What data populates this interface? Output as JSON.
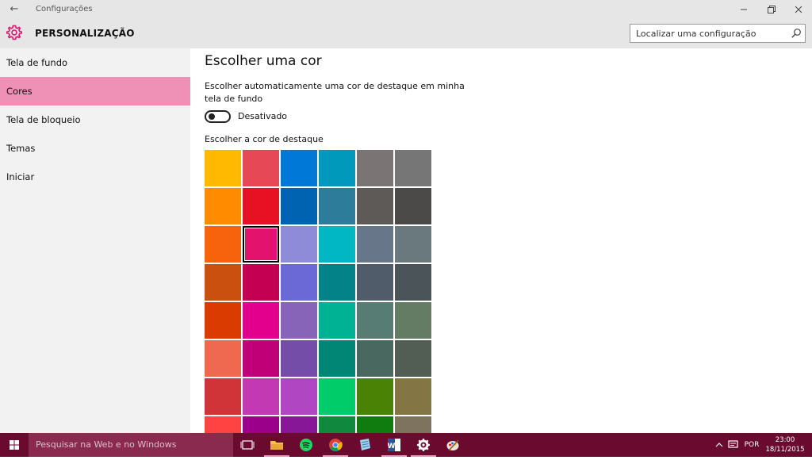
{
  "window": {
    "back_glyph": "←",
    "title": "Configurações",
    "controls": [
      "minimize-icon",
      "restore-icon",
      "close-icon"
    ]
  },
  "header": {
    "title": "PERSONALIZAÇÃO",
    "icon": "gear-icon",
    "accent_color": "#e3126d",
    "search_placeholder": "Localizar uma configuração"
  },
  "sidebar": {
    "active_index": 1,
    "active_color": "#ef90b7",
    "items": [
      {
        "label": "Tela de fundo"
      },
      {
        "label": "Cores"
      },
      {
        "label": "Tela de bloqueio"
      },
      {
        "label": "Temas"
      },
      {
        "label": "Iniciar"
      }
    ]
  },
  "main": {
    "title": "Escolher uma cor",
    "auto_accent_label": "Escolher automaticamente uma cor de destaque em minha tela de fundo",
    "toggle": {
      "state": "off",
      "label": "Desativado"
    },
    "accent_label": "Escolher a cor de destaque",
    "selected_color": "#e3126d",
    "swatches": [
      [
        "#ffb900",
        "#e74856",
        "#0078d7",
        "#0099bc",
        "#7a7574",
        "#767676"
      ],
      [
        "#ff8c00",
        "#e81123",
        "#0063b1",
        "#2d7d9a",
        "#5d5a58",
        "#4c4a48"
      ],
      [
        "#f7630c",
        "#e3126d",
        "#8e8cd8",
        "#00b7c3",
        "#68768a",
        "#69797e"
      ],
      [
        "#ca5010",
        "#c30052",
        "#6b69d6",
        "#038387",
        "#515c6b",
        "#4a5459"
      ],
      [
        "#da3b01",
        "#e3008c",
        "#8764b8",
        "#00b294",
        "#567c73",
        "#647c64"
      ],
      [
        "#ef6950",
        "#bf0077",
        "#744da9",
        "#018574",
        "#486860",
        "#525e54"
      ],
      [
        "#d13438",
        "#c239b3",
        "#b146c2",
        "#00cc6a",
        "#498205",
        "#847545"
      ],
      [
        "#ff4343",
        "#9a0089",
        "#881798",
        "#10893e",
        "#107c10",
        "#7e735f"
      ]
    ]
  },
  "taskbar": {
    "search_placeholder": "Pesquisar na Web e no Windows",
    "color": "#6a0a2f",
    "apps": [
      "task-view-icon",
      "file-explorer-icon",
      "spotify-icon",
      "chrome-icon",
      "notepad-icon",
      "word-icon",
      "settings-icon",
      "paint-icon"
    ],
    "language": "POR",
    "time": "23:00",
    "date": "18/11/2015"
  }
}
